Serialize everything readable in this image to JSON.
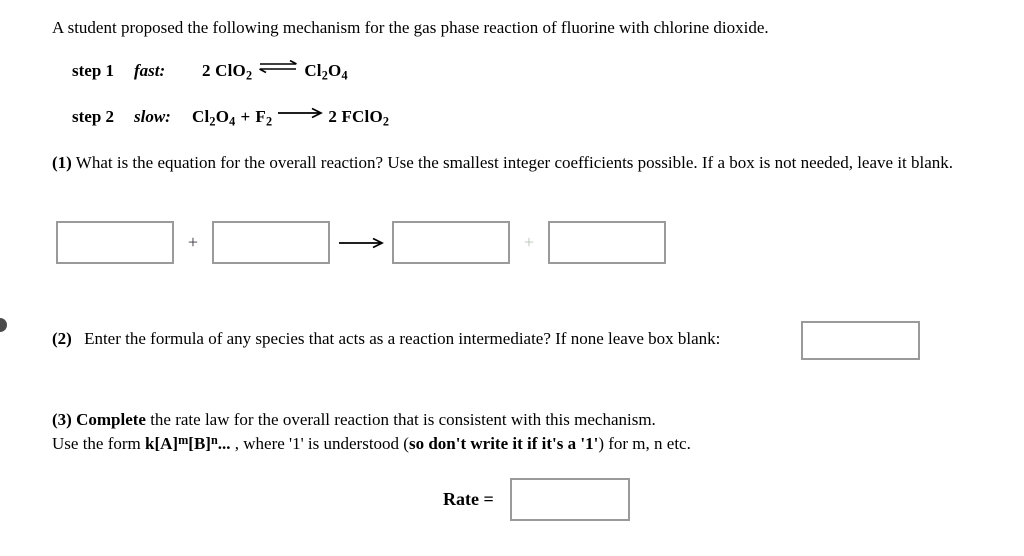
{
  "document": {
    "intro": "A student proposed the following mechanism for the gas phase reaction of fluorine with chlorine dioxide."
  },
  "mechanism": {
    "steps": [
      {
        "label": "step 1",
        "speed": "fast:",
        "arrow": "equilibrium",
        "arrow_glyph": "⇌",
        "left": {
          "coefficient": "2",
          "species": "ClO2",
          "display": "2 ClO₂"
        },
        "right": {
          "coefficient": "",
          "species": "Cl2O4",
          "display": "Cl₂O₄"
        },
        "equation": "2 ClO₂ ⇌ Cl₂O₄"
      },
      {
        "label": "step 2",
        "speed": "slow:",
        "arrow": "single",
        "arrow_glyph": "⟶",
        "left": {
          "coefficient": "",
          "species": "Cl2O4 + F2",
          "display": "Cl₂O₄ + F₂"
        },
        "right": {
          "coefficient": "2",
          "species": "FClO2",
          "display": "2 FClO₂"
        },
        "equation": "Cl₂O₄ + F₂ ⟶ 2 FClO₂"
      }
    ]
  },
  "questions": {
    "q1": {
      "number": "(1)",
      "text": "What is the equation for the overall reaction? Use the smallest integer coefficients possible. If a box is not needed, leave it blank.",
      "boxes": [
        {
          "name": "reactant-1",
          "value": "",
          "placeholder": ""
        },
        {
          "name": "reactant-2",
          "value": "",
          "placeholder": ""
        },
        {
          "name": "product-1",
          "value": "",
          "placeholder": ""
        },
        {
          "name": "product-2",
          "value": "",
          "placeholder": ""
        }
      ],
      "separators": {
        "plus": "+",
        "arrow": "⟶"
      }
    },
    "q2": {
      "number": "(2)",
      "text": "Enter the formula of any species that acts as a reaction intermediate? If none leave box blank:",
      "box": {
        "name": "intermediate",
        "value": "",
        "placeholder": ""
      }
    },
    "q3": {
      "number": "(3)",
      "bold_lead": "Complete",
      "line1_rest": " the rate law for the overall reaction that is consistent with this mechanism.",
      "line2_a": "Use the form ",
      "line2_form_k": "k[A]",
      "line2_form_m": "m",
      "line2_form_b": "[B]",
      "line2_form_n": "n",
      "line2_form_ellipsis": "...",
      "line2_b": " , where '1' is understood (",
      "line2_bold": "so don't write it if it's a '1'",
      "line2_c": ") for m, n etc.",
      "rate_label": "Rate =",
      "box": {
        "name": "rate-law",
        "value": "",
        "placeholder": ""
      }
    }
  },
  "style": {
    "box_border_color": "#9a9a9a",
    "text_color": "#000000",
    "background": "#ffffff"
  }
}
